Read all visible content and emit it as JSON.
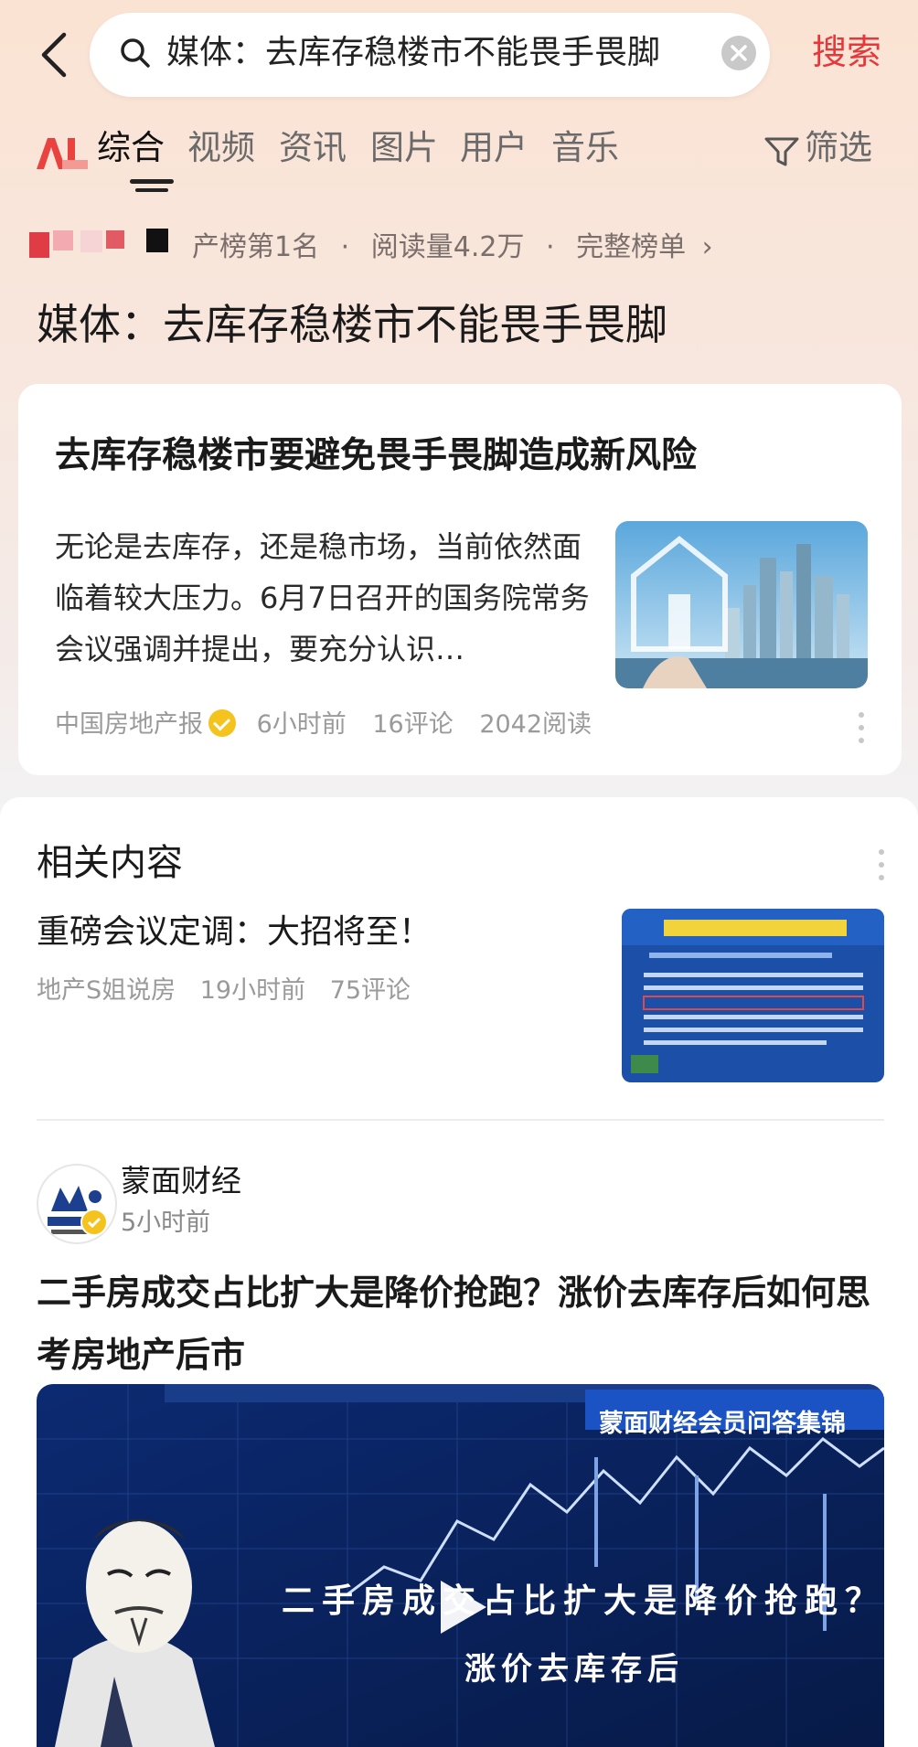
{
  "search": {
    "query": "媒体：去库存稳楼市不能畏手畏脚",
    "button_label": "搜索"
  },
  "tabs": [
    {
      "label": "综合",
      "active": true
    },
    {
      "label": "视频"
    },
    {
      "label": "资讯"
    },
    {
      "label": "图片"
    },
    {
      "label": "用户"
    },
    {
      "label": "音乐"
    },
    {
      "label": "筛选"
    }
  ],
  "hot_rank": {
    "rank_text": "产榜第1名",
    "reads": "阅读量4.2万",
    "full_list_link": "完整榜单"
  },
  "headline": "媒体：去库存稳楼市不能畏手畏脚",
  "featured_article": {
    "title": "去库存稳楼市要避免畏手畏脚造成新风险",
    "summary": "无论是去库存，还是稳市场，当前依然面临着较大压力。6月7日召开的国务院常务会议强调并提出，要充分认识…",
    "source": "中国房地产报",
    "time": "6小时前",
    "comments": "16评论",
    "reads": "2042阅读"
  },
  "related": {
    "section_title": "相关内容",
    "item": {
      "title": "重磅会议定调：大招将至！",
      "source": "地产S姐说房",
      "time": "19小时前",
      "comments": "75评论"
    }
  },
  "post": {
    "author": "蒙面财经",
    "time": "5小时前",
    "title": "二手房成交占比扩大是降价抢跑？涨价去库存后如何思考房地产后市",
    "video_tag": "蒙面财经会员问答集锦",
    "caption_line1": "二手房成交占比扩大是降价抢跑？",
    "caption_line2": "涨价去库存后"
  },
  "colors": {
    "accent": "#e8373a",
    "verified": "#f5c31e",
    "video_bg": "#0f2a66"
  },
  "icons": [
    "back-arrow-icon",
    "search-icon",
    "clear-icon",
    "ai-logo-icon",
    "filter-icon",
    "chevron-right-icon",
    "verified-icon",
    "more-icon",
    "play-icon"
  ]
}
